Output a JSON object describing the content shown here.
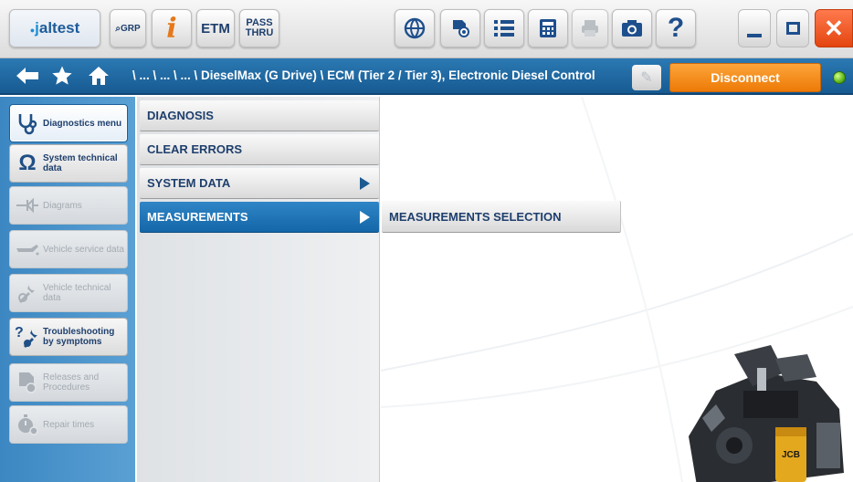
{
  "toolbar": {
    "logo": {
      "dot": "●",
      "prefix": "j",
      "name": "altest"
    },
    "grp_label": "GRP",
    "info_glyph": "i",
    "etm_label": "ETM",
    "pass_line1": "PASS",
    "pass_line2": "THRU",
    "help_glyph": "?",
    "close_glyph": "✕",
    "icons": [
      "globe-icon",
      "view-icon",
      "list-icon",
      "calculator-icon",
      "print-icon",
      "camera-icon",
      "help-icon"
    ]
  },
  "nav": {
    "breadcrumb": "\\ ... \\ ... \\ ... \\ DieselMax (G Drive) \\ ECM (Tier 2 / Tier 3), Electronic Diesel Control",
    "disconnect_label": "Disconnect",
    "status_color": "#5fb81b"
  },
  "sidebar": {
    "items": [
      {
        "label": "Diagnostics menu",
        "state": "active"
      },
      {
        "label": "System technical data",
        "state": "enabled"
      },
      {
        "label": "Diagrams",
        "state": "disabled"
      },
      {
        "label": "Vehicle service data",
        "state": "disabled"
      },
      {
        "label": "Vehicle technical data",
        "state": "disabled"
      },
      {
        "label": "Troubleshooting by symptoms",
        "state": "enabled"
      },
      {
        "label": "Releases and Procedures",
        "state": "disabled"
      },
      {
        "label": "Repair times",
        "state": "disabled"
      }
    ]
  },
  "menu": {
    "items": [
      {
        "label": "DIAGNOSIS",
        "has_submenu": false
      },
      {
        "label": "CLEAR ERRORS",
        "has_submenu": false
      },
      {
        "label": "SYSTEM DATA",
        "has_submenu": true
      },
      {
        "label": "MEASUREMENTS",
        "has_submenu": true,
        "selected": true
      }
    ],
    "submenu": [
      "MEASUREMENTS SELECTION"
    ]
  },
  "colors": {
    "accent_blue": "#1467a8",
    "disconnect_orange": "#f28a12",
    "close_red": "#e44510"
  }
}
